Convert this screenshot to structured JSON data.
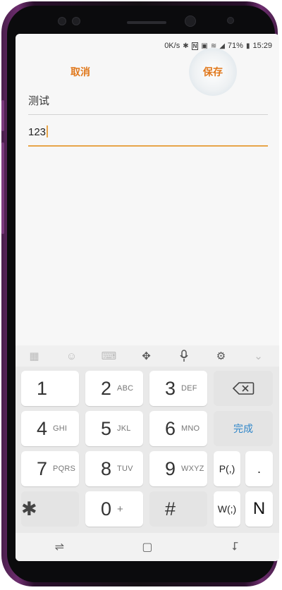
{
  "status_bar": {
    "net_speed": "0K/s",
    "battery": "71%",
    "time": "15:29",
    "icons": [
      "bluetooth-icon",
      "nfc-icon",
      "vibrate-icon",
      "wifi-icon",
      "signal-icon",
      "battery-icon"
    ]
  },
  "action_bar": {
    "cancel_label": "取消",
    "save_label": "保存"
  },
  "form": {
    "name_value": "测试",
    "number_value": "123"
  },
  "keyboard_toolbar": {
    "icons": [
      "grid-icon",
      "emoji-icon",
      "keyboard-icon",
      "cursor-move-icon",
      "microphone-icon",
      "gear-icon",
      "chevron-down-icon"
    ]
  },
  "keypad": {
    "keys": [
      {
        "main": "1",
        "sub": ""
      },
      {
        "main": "2",
        "sub": "ABC"
      },
      {
        "main": "3",
        "sub": "DEF"
      },
      {
        "main": "4",
        "sub": "GHI"
      },
      {
        "main": "5",
        "sub": "JKL"
      },
      {
        "main": "6",
        "sub": "MNO"
      },
      {
        "main": "7",
        "sub": "PQRS"
      },
      {
        "main": "8",
        "sub": "TUV"
      },
      {
        "main": "9",
        "sub": "WXYZ"
      },
      {
        "main": "✱",
        "sub": ""
      },
      {
        "main": "0",
        "sub": "+"
      },
      {
        "main": "#",
        "sub": ""
      }
    ],
    "done_label": "完成",
    "pause_label": "P(,)",
    "wait_label": "W(;)",
    "dot_label": ".",
    "n_label": "N"
  },
  "nav_bar": {
    "icons": [
      "recent-apps-icon",
      "home-icon",
      "back-icon"
    ]
  },
  "colors": {
    "accent_orange": "#e0781c",
    "done_blue": "#2f86c9",
    "phone_purple": "#6d2d6e"
  }
}
